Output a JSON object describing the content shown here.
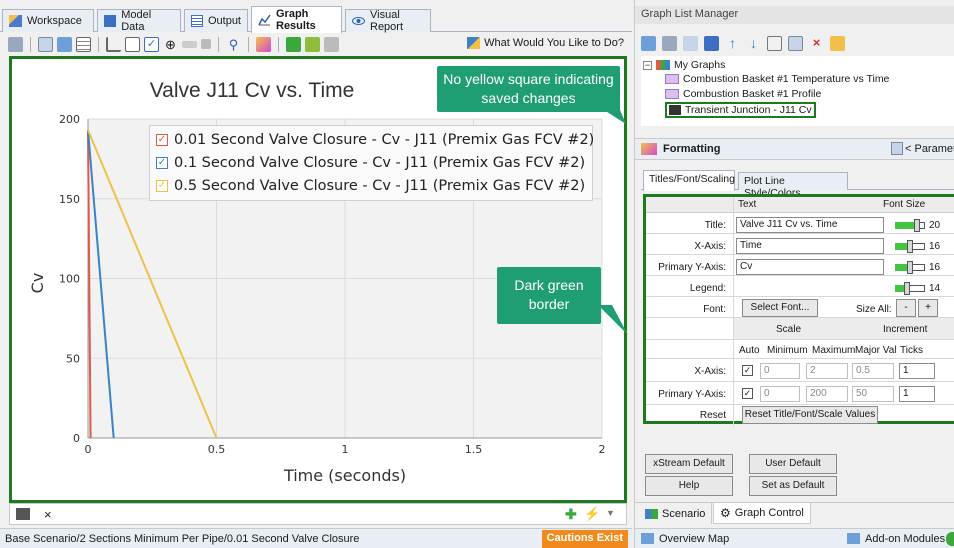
{
  "tabs": [
    {
      "label": "Workspace",
      "icon": "workspace-icon",
      "color": "#4a7bd0"
    },
    {
      "label": "Model Data",
      "icon": "model-data-icon",
      "color": "#3c6fc4"
    },
    {
      "label": "Output",
      "icon": "output-icon",
      "color": "#3c6fc4"
    },
    {
      "label": "Graph Results",
      "icon": "graph-results-icon",
      "color": "#2b5fb4"
    },
    {
      "label": "Visual Report",
      "icon": "visual-report-icon",
      "color": "#2b5fb4"
    }
  ],
  "toolbar": {
    "help_label": "What Would You Like to Do?"
  },
  "chart_data": {
    "type": "line",
    "title": "Valve J11 Cv vs. Time",
    "xlabel": "Time (seconds)",
    "ylabel": "Cv",
    "xlim": [
      0,
      2
    ],
    "ylim": [
      0,
      200
    ],
    "xticks": [
      "0",
      "0.5",
      "1",
      "1.5",
      "2"
    ],
    "yticks": [
      "0",
      "50",
      "100",
      "150",
      "200"
    ],
    "legend": "top-right",
    "grid": true,
    "series": [
      {
        "name": "0.01 Second Valve Closure - Cv - J11 (Premix Gas FCV #2)",
        "color": "#e05a4a",
        "x": [
          0,
          0.01
        ],
        "y": [
          193,
          0
        ]
      },
      {
        "name": "0.1 Second Valve Closure - Cv - J11 (Premix Gas FCV #2)",
        "color": "#3c82c4",
        "x": [
          0,
          0.1
        ],
        "y": [
          193,
          0
        ]
      },
      {
        "name": "0.5 Second Valve Closure - Cv - J11 (Premix Gas FCV #2)",
        "color": "#f2c04a",
        "x": [
          0,
          0.5
        ],
        "y": [
          193,
          0
        ]
      }
    ]
  },
  "callouts": {
    "saved": "No yellow square indicating saved changes",
    "border": "Dark green border"
  },
  "status": {
    "path": "Base Scenario/2 Sections Minimum Per Pipe/0.01 Second Valve Closure",
    "cautions": "Cautions Exist"
  },
  "glm": {
    "title": "Graph List Manager",
    "tree": {
      "root": "My Graphs",
      "items": [
        "Combustion Basket #1 Temperature vs Time",
        "Combustion Basket #1 Profile",
        "Transient Junction - J11 Cv"
      ]
    }
  },
  "formatting": {
    "title": "Formatting",
    "param_link": "< Parameters",
    "tab_active": "Titles/Font/Scaling",
    "tab_other": "Plot Line Style/Colors",
    "col_text": "Text",
    "col_font_size": "Font Size",
    "rows": [
      {
        "label": "Title:",
        "value": "Valve J11 Cv vs. Time",
        "size": "20",
        "level": 0.75
      },
      {
        "label": "X-Axis:",
        "value": "Time",
        "size": "16",
        "level": 0.5
      },
      {
        "label": "Primary Y-Axis:",
        "value": "Cv",
        "size": "16",
        "level": 0.5
      },
      {
        "label": "Legend:",
        "value": "",
        "size": "14",
        "level": 0.4
      }
    ],
    "font_label": "Font:",
    "select_font": "Select Font...",
    "size_all": "Size All:",
    "minus": "-",
    "plus": "+",
    "scale_hdr": "Scale",
    "increment_hdr": "Increment",
    "scale_cols": [
      "Auto",
      "Minimum",
      "Maximum",
      "Major Val",
      "Ticks"
    ],
    "scale_rows": [
      {
        "label": "X-Axis:",
        "auto": true,
        "min": "0",
        "max": "2",
        "major": "0.5",
        "ticks": "1"
      },
      {
        "label": "Primary Y-Axis:",
        "auto": true,
        "min": "0",
        "max": "200",
        "major": "50",
        "ticks": "1"
      }
    ],
    "reset_label": "Reset",
    "reset_btn": "Reset Title/Font/Scale Values"
  },
  "buttons": {
    "xstream": "xStream Default",
    "user_default": "User Default",
    "help": "Help",
    "set_default": "Set as Default"
  },
  "bottom_tabs": {
    "scenario": "Scenario",
    "graph_control": "Graph Control"
  },
  "right_status": {
    "overview": "Overview Map",
    "addon": "Add-on Modules"
  }
}
